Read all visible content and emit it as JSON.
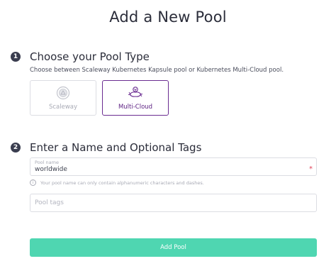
{
  "page": {
    "title": "Add a New Pool"
  },
  "step1": {
    "number": "1",
    "title": "Choose your Pool Type",
    "description": "Choose between Scaleway Kubernetes Kapsule pool or Kubernetes Multi-Cloud pool.",
    "options": [
      {
        "label": "Scaleway",
        "icon": "scaleway-icon",
        "state": "disabled"
      },
      {
        "label": "Multi-Cloud",
        "icon": "multi-cloud-icon",
        "state": "selected"
      }
    ]
  },
  "step2": {
    "number": "2",
    "title": "Enter a Name and Optional Tags",
    "name_field": {
      "label": "Pool name",
      "value": "worldwide",
      "required_mark": "*"
    },
    "hint": "Your pool name can only contain alphanumeric characters and dashes.",
    "tags_field": {
      "placeholder": "Pool tags",
      "value": ""
    }
  },
  "actions": {
    "submit_label": "Add Pool"
  },
  "colors": {
    "accent": "#4fd6b1",
    "selected_border": "#6a2c91",
    "required": "#e0455b"
  }
}
